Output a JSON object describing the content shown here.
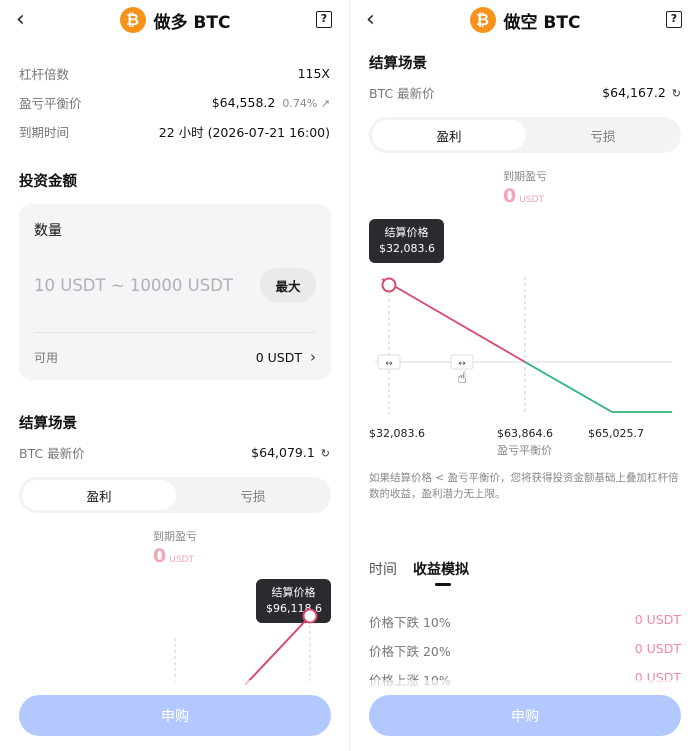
{
  "left": {
    "title": "做多 BTC",
    "coin_glyph": "₿",
    "leverage": {
      "label": "杠杆倍数",
      "value": "115X"
    },
    "breakeven": {
      "label": "盈亏平衡价",
      "value": "$64,558.2",
      "pct": "0.74% ↗"
    },
    "expiry": {
      "label": "到期时间",
      "value": "22 小时 (2026-07-21 16:00)"
    },
    "invest_title": "投资金额",
    "quantity": {
      "label": "数量",
      "placeholder": "10 USDT ~ 10000 USDT",
      "max_label": "最大"
    },
    "available": {
      "label": "可用",
      "value": "0 USDT"
    },
    "scenario_title": "结算场景",
    "latest": {
      "label": "BTC 最新价",
      "value": "$64,079.1"
    },
    "segment": {
      "profit": "盈利",
      "loss": "亏损"
    },
    "pnl": {
      "label": "到期盈亏",
      "value": "0",
      "unit": "USDT"
    },
    "tooltip": {
      "label": "结算价格",
      "value": "$96,118.6"
    },
    "cta": "申购"
  },
  "right": {
    "title": "做空 BTC",
    "coin_glyph": "₿",
    "scenario_title": "结算场景",
    "latest": {
      "label": "BTC 最新价",
      "value": "$64,167.2"
    },
    "segment": {
      "profit": "盈利",
      "loss": "亏损"
    },
    "pnl": {
      "label": "到期盈亏",
      "value": "0",
      "unit": "USDT"
    },
    "tooltip": {
      "label": "结算价格",
      "value": "$32,083.6"
    },
    "axis": {
      "left": "$32,083.6",
      "mid": "$63,864.6",
      "mid_sub": "盈亏平衡价",
      "right": "$65,025.7"
    },
    "note": "如果结算价格 < 盈亏平衡价，您将获得投资金额基础上叠加杠杆倍数的收益，盈利潜力无上限。",
    "tabs": [
      "时间",
      "收益模拟"
    ],
    "simulation": [
      {
        "label": "价格下跌 10%",
        "value": "0 USDT"
      },
      {
        "label": "价格下跌 20%",
        "value": "0 USDT"
      },
      {
        "label": "价格上涨 10%",
        "value": "0 USDT"
      }
    ],
    "cta": "申购"
  },
  "colors": {
    "profit_line": "#d94a6a",
    "loss_line": "#2bb57a",
    "cta": "#b3c8ff",
    "coin": "#f7931a"
  },
  "icons": {
    "back": "back-chevron-icon",
    "help": "help-doc-icon",
    "refresh": "refresh-icon",
    "chevron": "chevron-right-icon",
    "hand": "hand-pointer-icon",
    "drag": "drag-handle-icon"
  }
}
